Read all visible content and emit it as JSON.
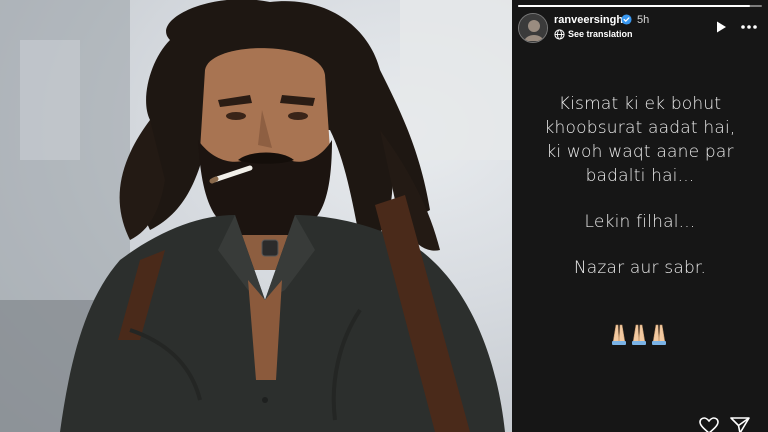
{
  "story": {
    "username": "ranveersingh",
    "time": "5h",
    "see_translation": "See translation",
    "progress": 0.95,
    "lines": [
      "Kismat ki ek bohut",
      "khoobsurat aadat hai,",
      "ki woh waqt aane par",
      "badalti hai..."
    ],
    "line_2": "Lekin filhal...",
    "line_3": "Nazar aur sabr.",
    "emoji": "🙏🙏🙏"
  },
  "icons": {
    "verified": "verified-badge-icon",
    "translate": "translate-icon",
    "play": "play-icon",
    "more": "more-icon",
    "heart": "heart-icon",
    "send": "send-icon"
  },
  "colors": {
    "story_bg": "#161616",
    "text": "#ececec",
    "verified": "#3897f0"
  }
}
